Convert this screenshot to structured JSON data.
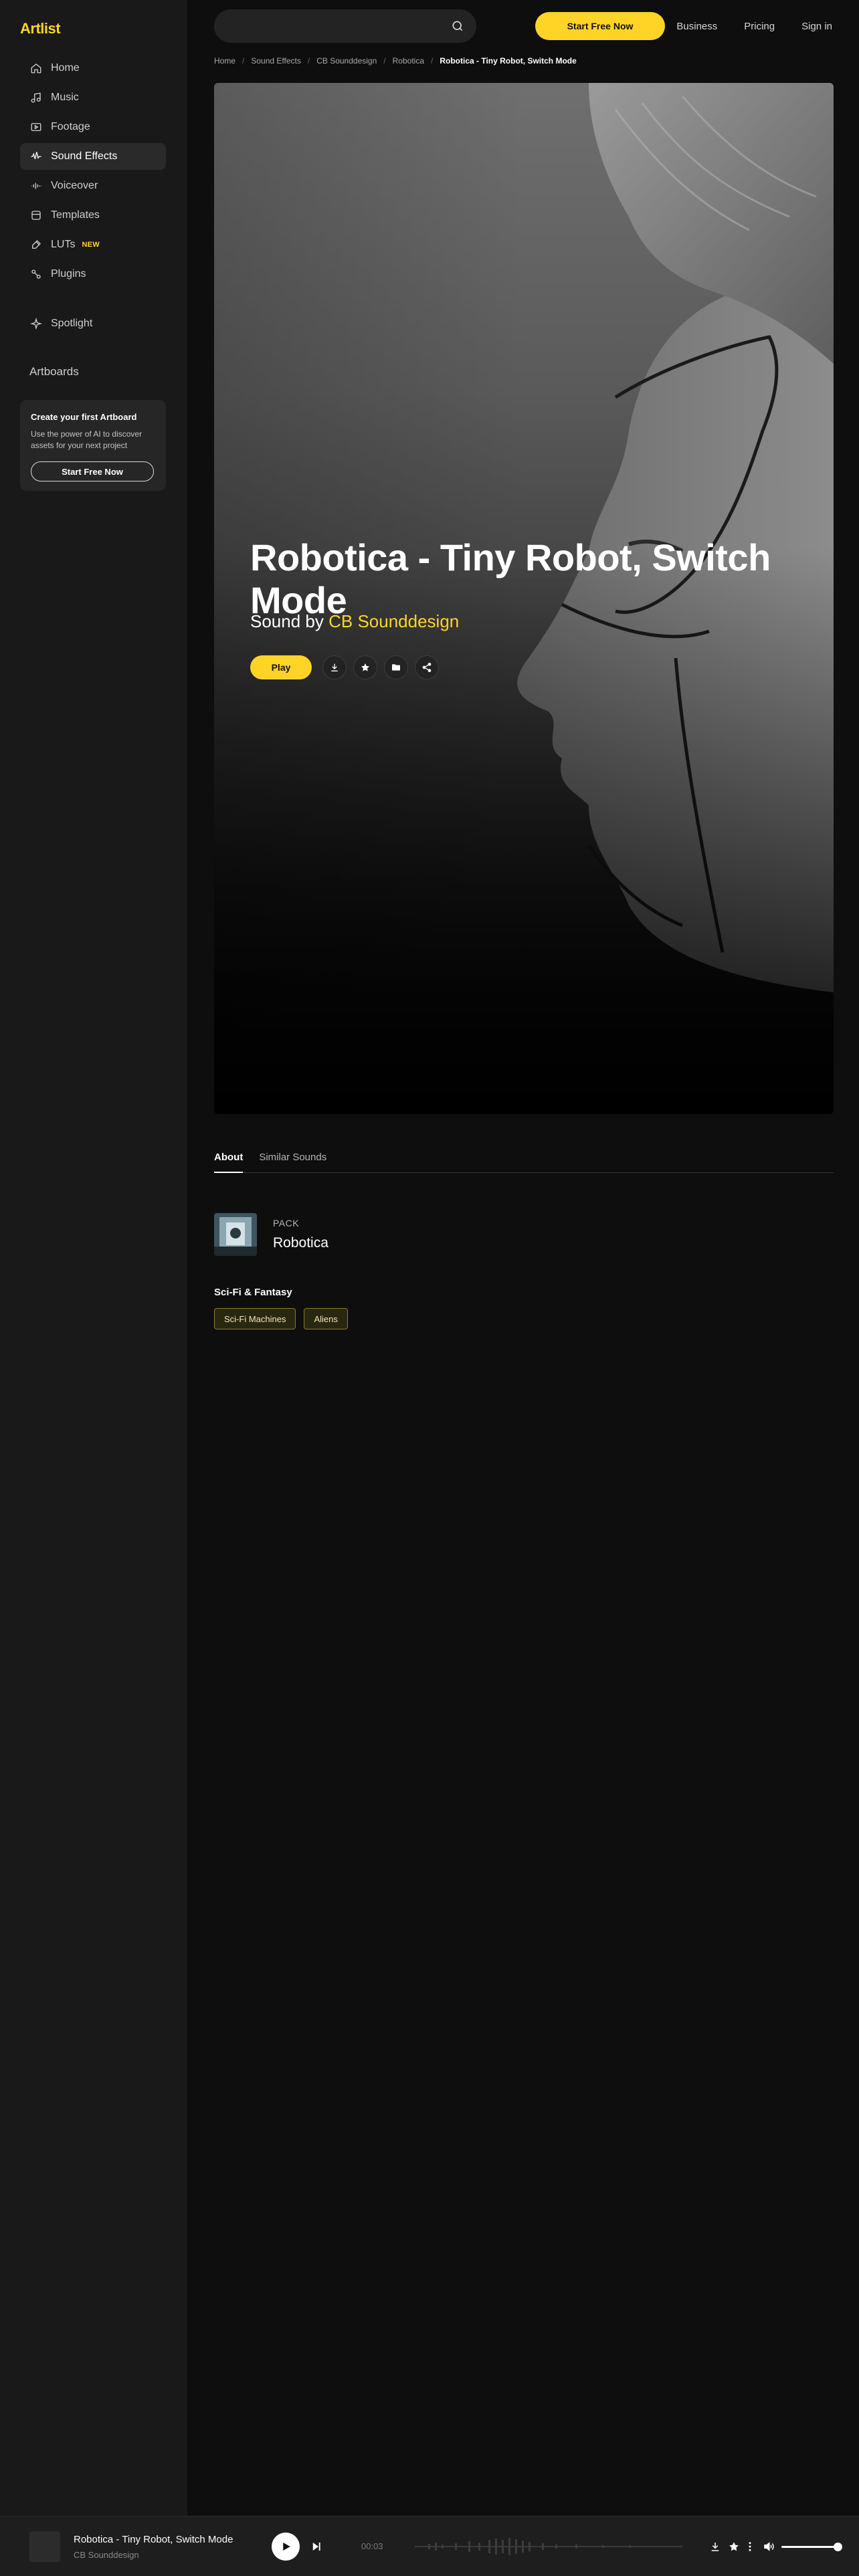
{
  "brand": {
    "logo_text": "Artlist",
    "accent": "#ffd426"
  },
  "sidebar": {
    "items": [
      {
        "label": "Home",
        "icon": "home-icon"
      },
      {
        "label": "Music",
        "icon": "music-note-icon"
      },
      {
        "label": "Footage",
        "icon": "play-square-icon"
      },
      {
        "label": "Sound Effects",
        "icon": "waveform-icon",
        "active": true
      },
      {
        "label": "Voiceover",
        "icon": "voice-wave-icon"
      },
      {
        "label": "Templates",
        "icon": "template-icon"
      },
      {
        "label": "LUTs",
        "icon": "brush-icon",
        "badge": "NEW"
      },
      {
        "label": "Plugins",
        "icon": "plugin-icon"
      }
    ],
    "spotlight": {
      "label": "Spotlight",
      "icon": "sparkle-icon"
    },
    "artboards": {
      "title": "Artboards",
      "card_title": "Create your first Artboard",
      "card_desc": "Use the power of AI to discover assets for your next project",
      "card_button": "Start Free Now"
    }
  },
  "header": {
    "search_placeholder": "",
    "cta": "Start Free Now",
    "links": [
      "Business",
      "Pricing",
      "Sign in"
    ]
  },
  "breadcrumb": [
    "Home",
    "Sound Effects",
    "CB Sounddesign",
    "Robotica",
    "Robotica - Tiny Robot, Switch Mode"
  ],
  "hero": {
    "title": "Robotica - Tiny Robot, Switch Mode",
    "sub_prefix": "Sound by",
    "author": "CB Sounddesign",
    "play": "Play"
  },
  "tabs": [
    "About",
    "Similar Sounds"
  ],
  "pack": {
    "label": "PACK",
    "name": "Robotica"
  },
  "category": {
    "title": "Sci-Fi & Fantasy",
    "tags": [
      "Sci-Fi Machines",
      "Aliens"
    ]
  },
  "player": {
    "title": "Robotica - Tiny Robot, Switch Mode",
    "artist": "CB Sounddesign",
    "time": "00:03"
  }
}
